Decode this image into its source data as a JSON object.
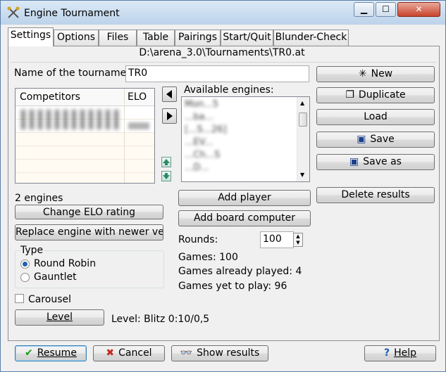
{
  "window": {
    "title": "Engine Tournament",
    "minimize": "▁",
    "maximize": "☐",
    "close": "✕"
  },
  "tabs": [
    "Settings",
    "Options",
    "Files",
    "Table",
    "Pairings",
    "Start/Quit",
    "Blunder-Check"
  ],
  "path": "D:\\arena_3.0\\Tournaments\\TR0.at",
  "tournament": {
    "name_label": "Name of the tournament",
    "name_value": "TR0"
  },
  "competitors": {
    "col_name": "Competitors",
    "col_elo": "ELO",
    "count_text": "2 engines"
  },
  "available": {
    "label": "Available engines:",
    "items": [
      "Mon...5",
      "...ba...",
      "[...S...26]",
      "...EV...",
      "...Ch...S",
      "...D..."
    ]
  },
  "buttons": {
    "new": "New",
    "duplicate": "Duplicate",
    "load": "Load",
    "save": "Save",
    "save_as": "Save as",
    "delete_results": "Delete results",
    "add_player": "Add player",
    "add_board_computer": "Add board computer",
    "change_elo": "Change ELO rating",
    "replace_engine": "Replace engine with newer versio",
    "level": "Level",
    "resume": "Resume",
    "cancel": "Cancel",
    "show_results": "Show results",
    "help": "Help"
  },
  "rounds": {
    "label": "Rounds:",
    "value": "100"
  },
  "stats": {
    "games": "Games: 100",
    "played": "Games already played: 4",
    "yet": "Games yet to play: 96"
  },
  "type": {
    "label": "Type",
    "options": [
      "Round Robin",
      "Gauntlet"
    ],
    "selected": "Round Robin"
  },
  "carousel": {
    "label": "Carousel",
    "checked": false
  },
  "level_text": "Level: Blitz 0:10/0,5",
  "colors": {
    "accent": "#1f5fb0",
    "titlebar": "#bcd3ea",
    "grid_row": "#fffaf2"
  }
}
